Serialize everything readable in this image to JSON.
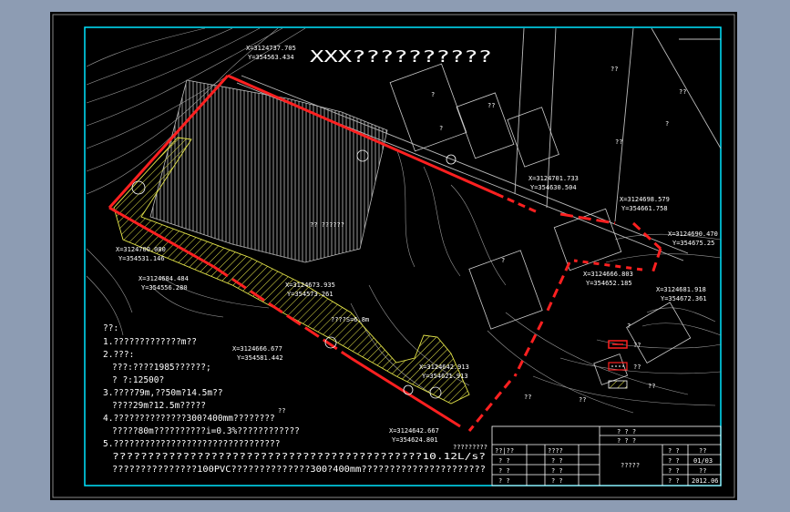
{
  "drawing": {
    "title": "XXX??????????",
    "coords": [
      {
        "x": "X=3124737.705",
        "y": "Y=354563.434"
      },
      {
        "x": "X=3124700.080",
        "y": "Y=354531.146"
      },
      {
        "x": "X=3124684.484",
        "y": "Y=354556.280"
      },
      {
        "x": "X=3124673.935",
        "y": "Y=354573.261"
      },
      {
        "x": "X=3124666.677",
        "y": "Y=354581.442"
      },
      {
        "x": "X=3124642.913",
        "y": "Y=354621.913"
      },
      {
        "x": "X=3124642.667",
        "y": "Y=354624.801"
      },
      {
        "x": "X=3124701.733",
        "y": "Y=354630.504"
      },
      {
        "x": "X=3124698.579",
        "y": "Y=354661.758"
      },
      {
        "x": "X=3124690.470",
        "y": "Y=354675.25"
      },
      {
        "x": "X=3124666.803",
        "y": "Y=354652.185"
      },
      {
        "x": "X=3124681.918",
        "y": "Y=354672.361"
      }
    ],
    "site_labels": {
      "park": "?? ??????",
      "area": "????S=6.8m",
      "corner_note": "?????????"
    },
    "map_labels": [
      "?",
      "?",
      "??",
      "??",
      "??",
      "?",
      "?",
      "??",
      "??",
      "??",
      "??"
    ]
  },
  "legend": {
    "items": [
      "?",
      "??",
      "??",
      "??"
    ]
  },
  "notes": {
    "header": "??:",
    "lines": [
      "1.?????????????m??",
      "2.???:",
      "???:????1985??????;",
      "?   ?:12500?",
      "3.????79m,??50m?14.5m??",
      "????29m?12.5m?????",
      "4.??????????????300?400mm????????",
      "?????80m??????????i=0.3%????????????",
      "5.????????????????????????????????",
      "????????????????????????????????????????????10.12L/s?",
      "???????????????100PVC??????????????300?400mm??????????????????????"
    ]
  },
  "title_block": {
    "top": "? ? ?",
    "mid": "? ? ?",
    "left_rows": [
      [
        "??|??",
        "????"
      ],
      [
        "? ?",
        "? ?"
      ],
      [
        "? ?",
        "? ?"
      ],
      [
        "? ?",
        "? ?"
      ]
    ],
    "center": "?????",
    "right_rows": [
      [
        "? ?",
        "??"
      ],
      [
        "? ?",
        "01/03"
      ],
      [
        "? ?",
        "??"
      ],
      [
        "? ?",
        "2012.06"
      ]
    ]
  }
}
